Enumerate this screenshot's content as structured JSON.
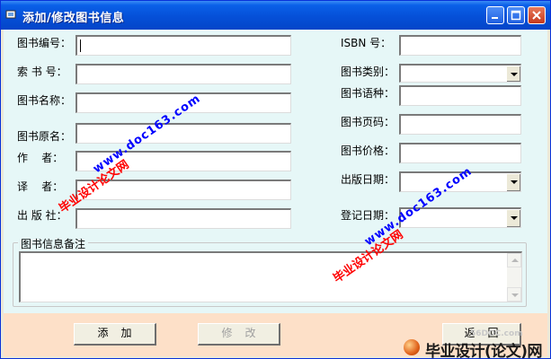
{
  "window": {
    "title": "添加/修改图书信息"
  },
  "form": {
    "left": [
      {
        "label": "图书编号：",
        "value": ""
      },
      {
        "label": "索 书 号：",
        "value": ""
      },
      {
        "label": "图书名称：",
        "value": ""
      },
      {
        "label": "图书原名：",
        "value": ""
      },
      {
        "label": "作    者：",
        "value": ""
      },
      {
        "label": "译    者：",
        "value": ""
      },
      {
        "label": "出 版 社：",
        "value": ""
      }
    ],
    "right": [
      {
        "label": "ISBN 号：",
        "value": ""
      },
      {
        "label": "图书类别：",
        "value": ""
      },
      {
        "label": "图书语种：",
        "value": ""
      },
      {
        "label": "图书页码：",
        "value": ""
      },
      {
        "label": "图书价格：",
        "value": ""
      },
      {
        "label": "出版日期：",
        "value": ""
      },
      {
        "label": "登记日期：",
        "value": ""
      }
    ],
    "notes_label": "图书信息备注",
    "notes_value": ""
  },
  "buttons": {
    "add": "添加",
    "modify": "修改",
    "back": "返回"
  },
  "watermarks": {
    "site_cn": "毕业设计论文网",
    "site_url": "www.doc163.com"
  },
  "branding": {
    "logo_text": "毕业设计(论文)网",
    "logo_url": "56DOC.com"
  }
}
